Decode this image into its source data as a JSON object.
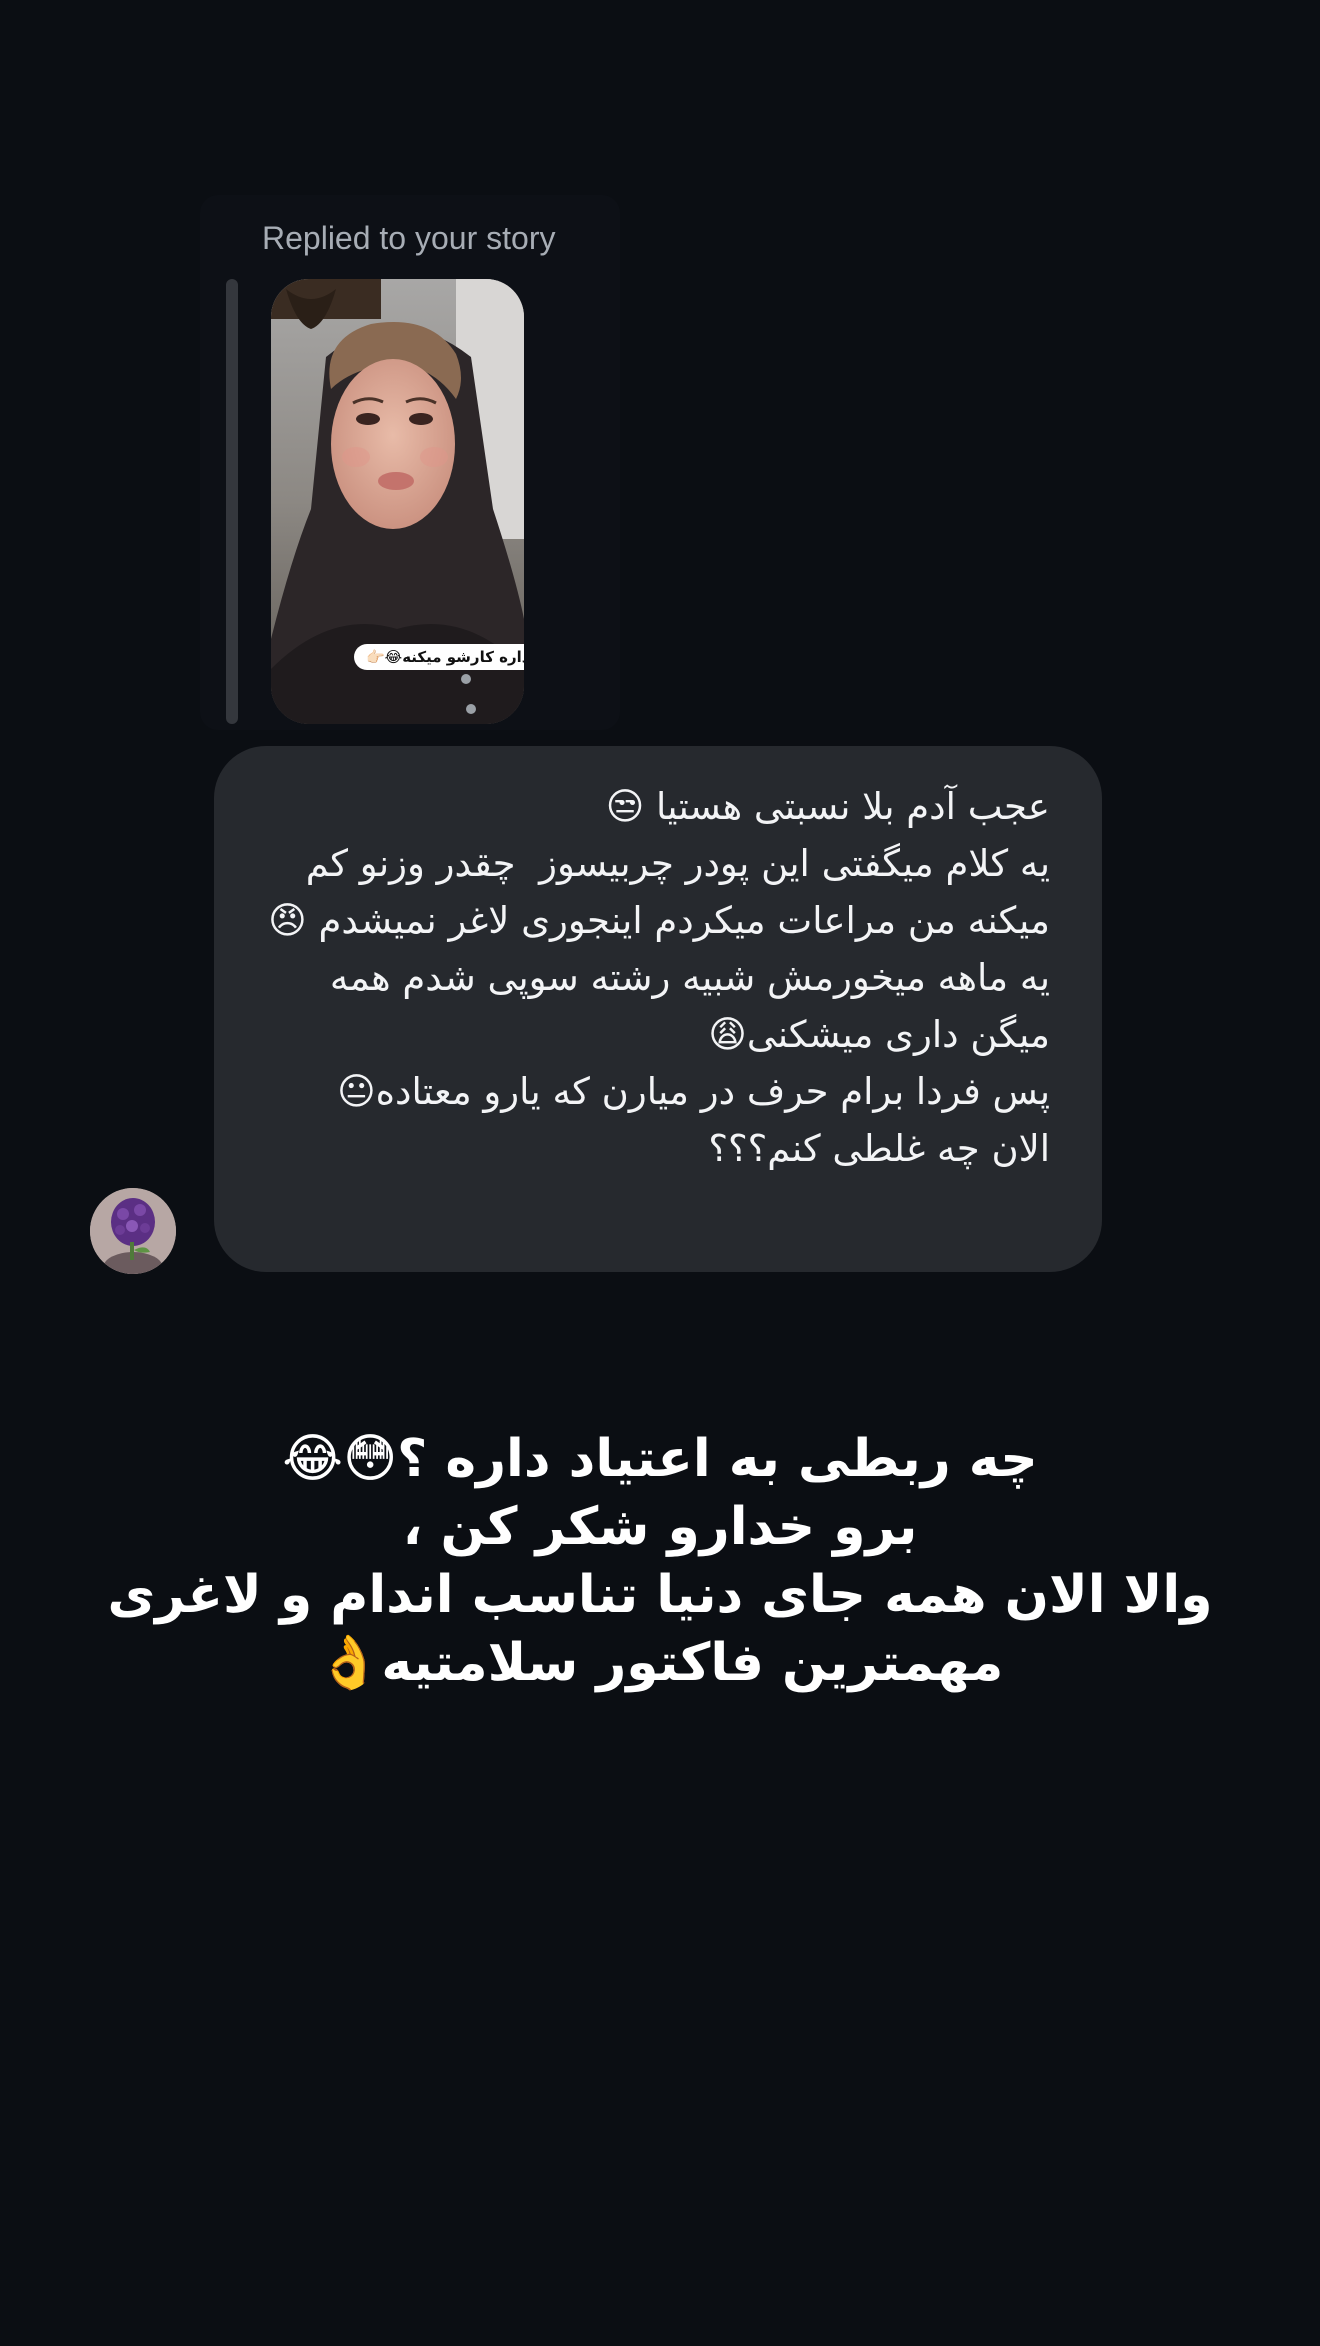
{
  "reply_header": {
    "label": "Replied to your story"
  },
  "story": {
    "caption": "داره کارشو میکنه😂👉🏻"
  },
  "message": {
    "text": "عجب آدم بلا نسبتی هستیا 😒\nیه کلام میگفتی این پودر چربیسوز  چقدر وزنو کم میکنه من مراعات میکردم اینجوری لاغر نمیشدم 😠\nیه ماهه میخورمش شبیه رشته سوپی شدم همه میگن داری میشکنی😩\nپس فردا برام حرف در میارن که یارو معتاده😐\nالان چه غلطی کنم؟؟؟"
  },
  "overlay": {
    "text": "چه ربطی به اعتیاد داره ؟😳😂\nبرو خدارو شکر کن ،\nوالا الان همه جای دنیا تناسب اندام و لاغری\nمهمترین فاکتور سلامتیه👌"
  }
}
